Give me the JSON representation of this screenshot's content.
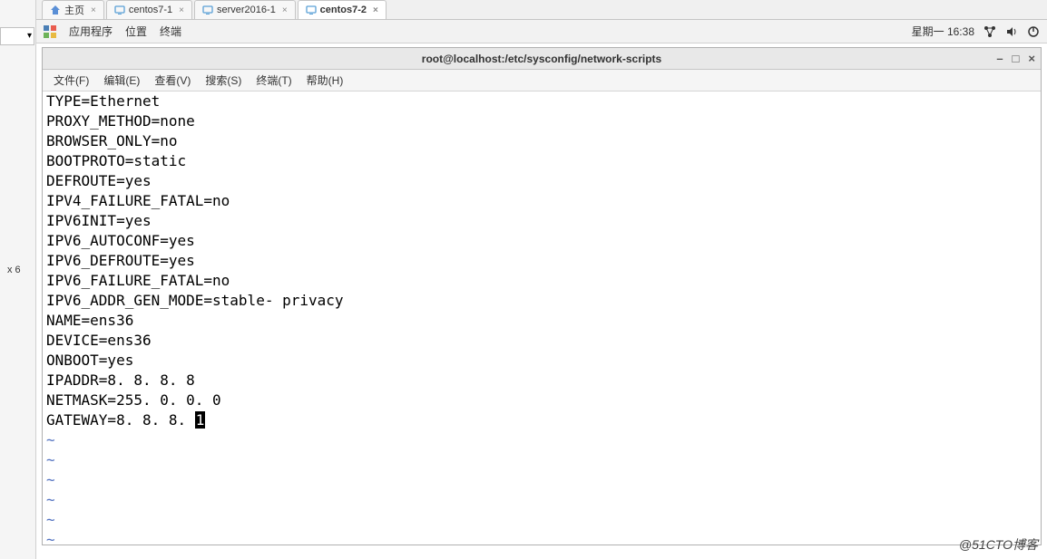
{
  "left_panel": {
    "label": "x 6",
    "dropdown_arrow": "▾"
  },
  "tabs": [
    {
      "label": "主页",
      "icon": "home-icon",
      "active": false
    },
    {
      "label": "centos7-1",
      "icon": "vm-icon",
      "active": false
    },
    {
      "label": "server2016-1",
      "icon": "vm-icon",
      "active": false
    },
    {
      "label": "centos7-2",
      "icon": "vm-icon",
      "active": true
    }
  ],
  "gnome": {
    "apps": "应用程序",
    "places": "位置",
    "terminal": "终端",
    "datetime": "星期一 16:38"
  },
  "window": {
    "title": "root@localhost:/etc/sysconfig/network-scripts"
  },
  "menu": {
    "file": "文件(F)",
    "edit": "编辑(E)",
    "view": "查看(V)",
    "search": "搜索(S)",
    "terminal": "终端(T)",
    "help": "帮助(H)"
  },
  "editor": {
    "lines": [
      "TYPE=Ethernet",
      "PROXY_METHOD=none",
      "BROWSER_ONLY=no",
      "BOOTPROTO=static",
      "DEFROUTE=yes",
      "IPV4_FAILURE_FATAL=no",
      "IPV6INIT=yes",
      "IPV6_AUTOCONF=yes",
      "IPV6_DEFROUTE=yes",
      "IPV6_FAILURE_FATAL=no",
      "IPV6_ADDR_GEN_MODE=stable- privacy",
      "NAME=ens36",
      "DEVICE=ens36",
      "ONBOOT=yes",
      "IPADDR=8. 8. 8. 8",
      "NETMASK=255. 0. 0. 0"
    ],
    "last_line_prefix": "GATEWAY=8. 8. 8. ",
    "cursor_char": "1",
    "tilde_count": 6
  },
  "watermark": "@51CTO博客"
}
